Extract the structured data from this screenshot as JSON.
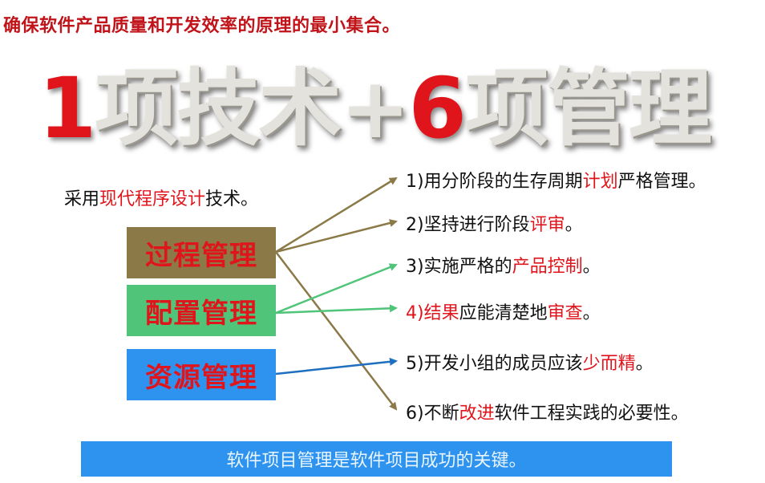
{
  "subtitle": "确保软件产品质量和开发效率的原理的最小集合。",
  "headline": {
    "num1": "1",
    "part1": "项技术",
    "plus": "+",
    "num2": "6",
    "part2": "项管理"
  },
  "tech_line": {
    "prefix": "采用",
    "highlight": "现代程序设计",
    "suffix": "技术。"
  },
  "boxes": [
    {
      "label": "过程管理",
      "color": "#8b7a47"
    },
    {
      "label": "配置管理",
      "color": "#50c478"
    },
    {
      "label": "资源管理",
      "color": "#2e93ee"
    }
  ],
  "items": [
    {
      "prefix": "1)用分阶段的生存周期",
      "highlight": "计划",
      "suffix": "严格管理。"
    },
    {
      "prefix": "2)坚持进行阶段",
      "highlight": "评审",
      "suffix": "。"
    },
    {
      "prefix": "3)实施严格的",
      "highlight": "产品控制",
      "suffix": "。"
    },
    {
      "highlight_num": "4)",
      "highlight": "结果",
      "mid": "应能清楚地",
      "highlight2": "审查",
      "suffix": "。"
    },
    {
      "prefix": "5)开发小组的成员应该",
      "highlight": "少而精",
      "suffix": "。"
    },
    {
      "prefix": "6)不断",
      "highlight": "改进",
      "suffix": "软件工程实践的必要性。"
    }
  ],
  "banner": "软件项目管理是软件项目成功的关键。",
  "colors": {
    "accent_red": "#e0151c",
    "process_arrow": "#8b7a47",
    "config_arrow": "#50c478",
    "resource_arrow": "#1f6fc0",
    "banner_bg": "#2e93ee"
  }
}
